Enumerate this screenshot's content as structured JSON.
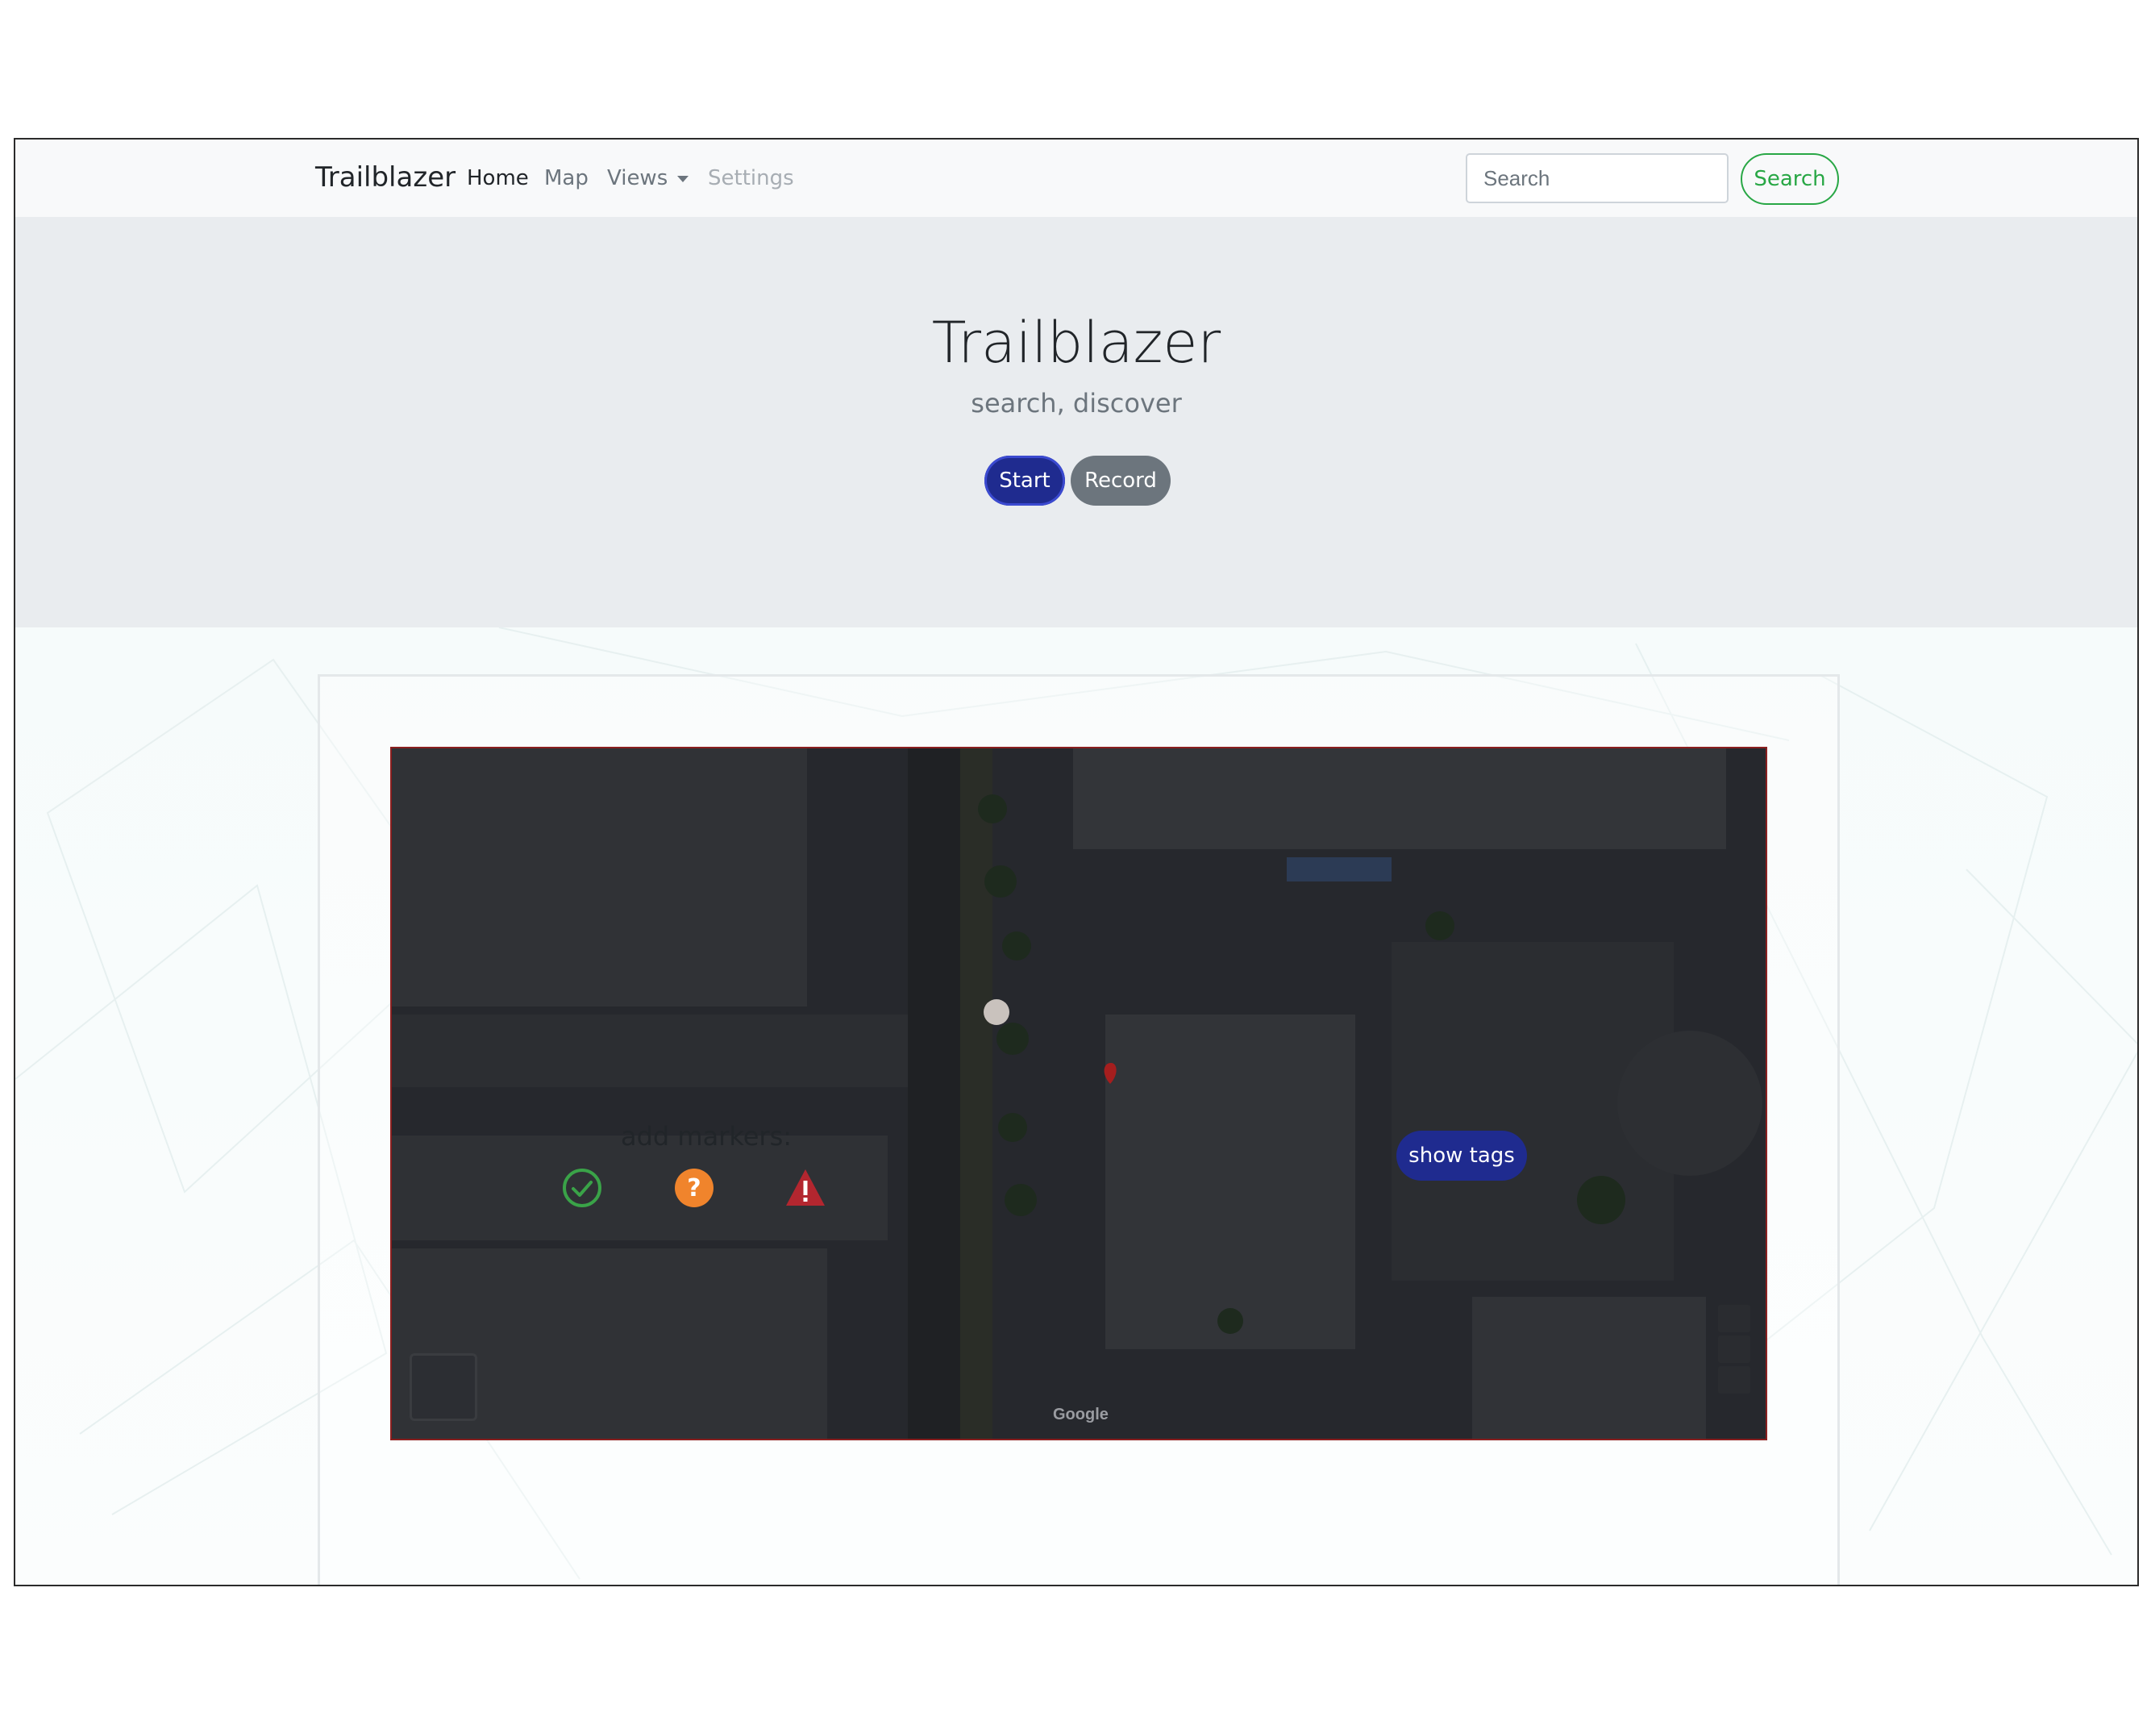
{
  "navbar": {
    "brand": "Trailblazer",
    "links": [
      {
        "label": "Home"
      },
      {
        "label": "Map"
      },
      {
        "label": "Views"
      },
      {
        "label": "Settings"
      }
    ],
    "search_placeholder": "Search",
    "search_button": "Search"
  },
  "jumbotron": {
    "title": "Trailblazer",
    "subtitle": "search, discover",
    "start_label": "Start",
    "record_label": "Record"
  },
  "map": {
    "attribution_logo": "Google"
  },
  "markers": {
    "label": "add markers:",
    "icons": [
      "check-circle-icon",
      "question-circle-icon",
      "warning-triangle-icon"
    ]
  },
  "show_tags_label": "show tags",
  "colors": {
    "primary": "#1f2b8f",
    "secondary": "#6c757d",
    "success": "#28a745",
    "warning": "#f0842c",
    "danger": "#b3262f"
  }
}
